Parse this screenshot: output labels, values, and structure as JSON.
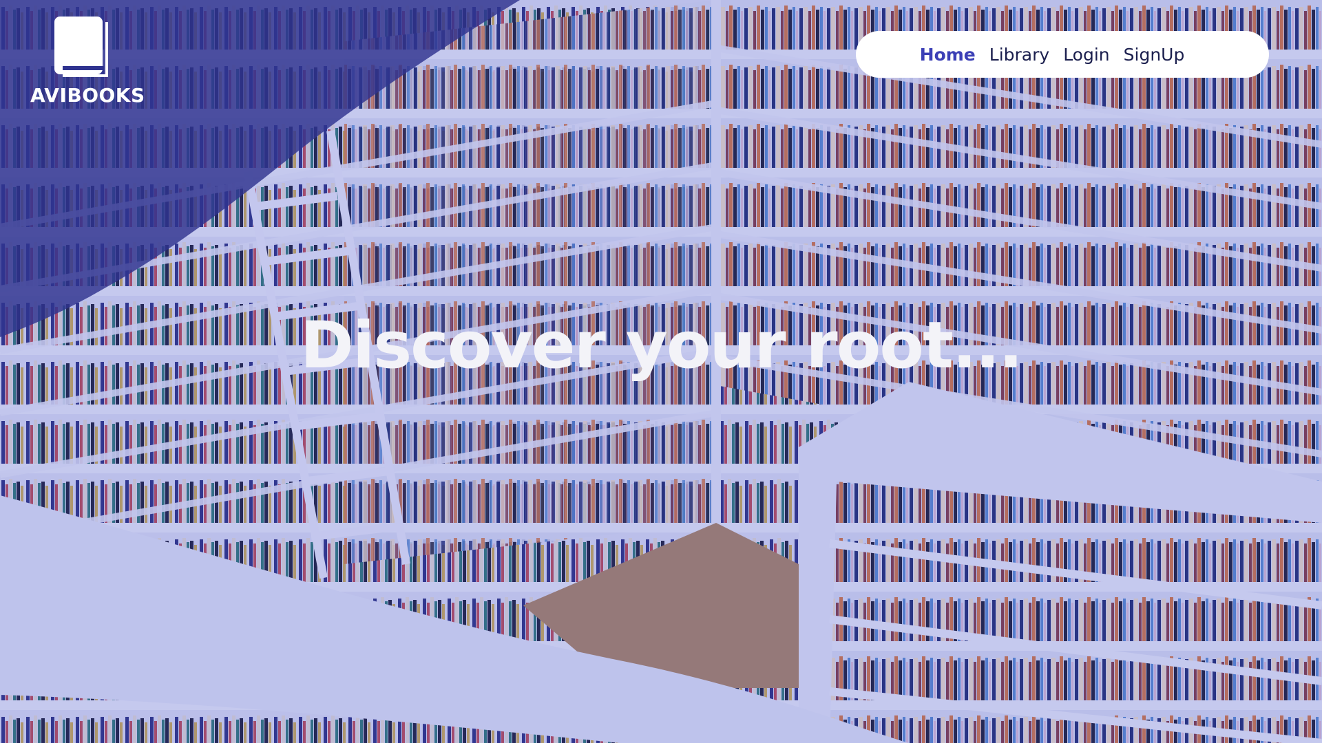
{
  "brand": {
    "name": "AVIBOOKS",
    "logo_icon": "book-icon"
  },
  "nav": {
    "items": [
      {
        "label": "Home",
        "active": true
      },
      {
        "label": "Library",
        "active": false
      },
      {
        "label": "Login",
        "active": false
      },
      {
        "label": "SignUp",
        "active": false
      }
    ]
  },
  "hero": {
    "headline": "Discover your root..."
  },
  "colors": {
    "accent": "#3b3fb6",
    "nav_text": "#1b1f4e",
    "corner_overlay": "#2f338f",
    "tint": "#5c64c8"
  }
}
